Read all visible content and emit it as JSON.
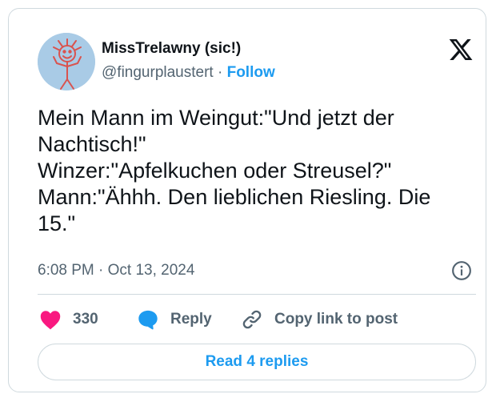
{
  "author": {
    "display_name": "MissTrelawny (sic!)",
    "handle": "@fingurplaustert",
    "separator": "·",
    "follow_label": "Follow",
    "avatar_icon": "stick-figure-sun-avatar"
  },
  "platform": {
    "icon": "x-logo-icon"
  },
  "tweet": {
    "lines": [
      "Mein Mann im Weingut:\"Und jetzt der",
      "Nachtisch!\"",
      "Winzer:\"Apfelkuchen oder Streusel?\"",
      "Mann:\"Ähhh. Den lieblichen Riesling. Die",
      "15.\""
    ]
  },
  "meta": {
    "timestamp": "6:08 PM · Oct 13, 2024",
    "info_icon": "info-icon"
  },
  "actions": {
    "likes_count": "330",
    "reply_label": "Reply",
    "copy_link_label": "Copy link to post"
  },
  "footer": {
    "read_replies_label": "Read 4 replies"
  },
  "colors": {
    "accent": "#1d9bf0",
    "like": "#f91880",
    "text_primary": "#0f1419",
    "text_secondary": "#536471",
    "border": "#cfd9de",
    "avatar_bg": "#a9cbe6",
    "avatar_drawing": "#d9534f"
  }
}
